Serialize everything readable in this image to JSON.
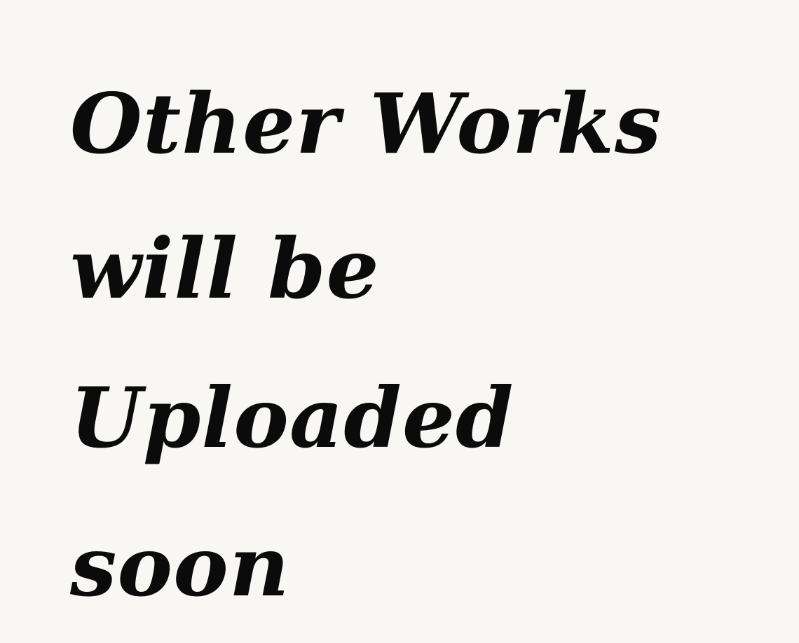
{
  "message": {
    "lines": [
      "Other Works",
      "will be",
      "Uploaded",
      "soon"
    ]
  },
  "colors": {
    "background": "#f9f7f4",
    "text": "#0b0b0b"
  }
}
